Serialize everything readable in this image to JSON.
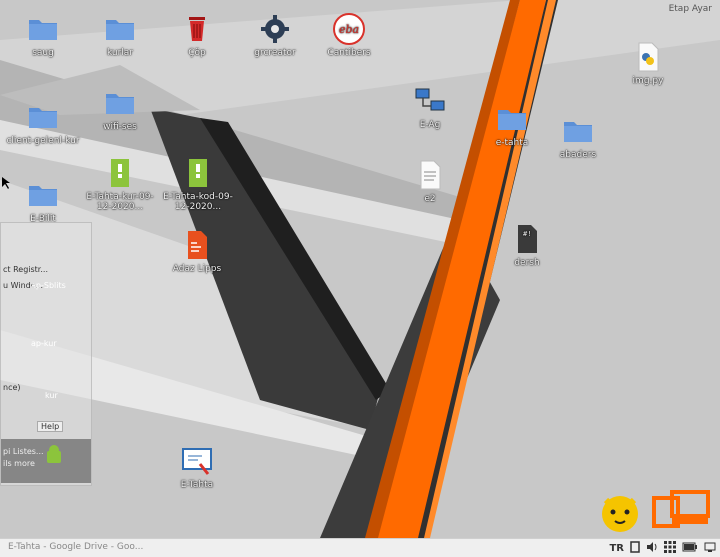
{
  "top_right": {
    "label": "Etap Ayar"
  },
  "desktop_icons": [
    {
      "id": "saug",
      "label": "saug",
      "type": "folder"
    },
    {
      "id": "kurlar",
      "label": "kurlar",
      "type": "folder"
    },
    {
      "id": "cop",
      "label": "Çöp",
      "type": "trash"
    },
    {
      "id": "grcreator",
      "label": "grcreator",
      "type": "gear"
    },
    {
      "id": "cantibers",
      "label": "Cantibers",
      "type": "eba"
    },
    {
      "id": "img",
      "label": "img.py",
      "type": "python"
    },
    {
      "id": "client",
      "label": "client-gelenl-kur",
      "type": "folder"
    },
    {
      "id": "wifi",
      "label": "wifi-ses",
      "type": "folder"
    },
    {
      "id": "eag",
      "label": "E-Ag",
      "type": "network"
    },
    {
      "id": "etahta_folder",
      "label": "e-tahta",
      "type": "folder"
    },
    {
      "id": "abaders",
      "label": "abaders",
      "type": "folder"
    },
    {
      "id": "etahta_kur",
      "label": "E-Tahta-kur-09-12-2020...",
      "type": "zip"
    },
    {
      "id": "etahta_kod",
      "label": "E-Tahta-kod-09-12-2020...",
      "type": "zip"
    },
    {
      "id": "dosya",
      "label": "e2",
      "type": "text"
    },
    {
      "id": "ebilit",
      "label": "E-Bilit",
      "type": "folder"
    },
    {
      "id": "adaz",
      "label": "Adaz Lipps",
      "type": "slides"
    },
    {
      "id": "dersh",
      "label": "dersh",
      "type": "script"
    },
    {
      "id": "etahta_app",
      "label": "E-Tahta",
      "type": "board"
    }
  ],
  "overlay_window": {
    "rows": [
      "ct Registr...",
      "u Windo...",
      "ap-Sblits",
      "ap-kur",
      "kur",
      "nce)",
      "Help",
      "pi Listes...",
      "ils more"
    ]
  },
  "taskbar": {
    "tasks": [
      "E-Tahta - Google Drive - Goo..."
    ],
    "lang": "TR"
  },
  "colors": {
    "folder": "#5b8fd6",
    "orange": "#ff6a00",
    "dark_stripe": "#333333",
    "taskbar": "#efefef"
  }
}
